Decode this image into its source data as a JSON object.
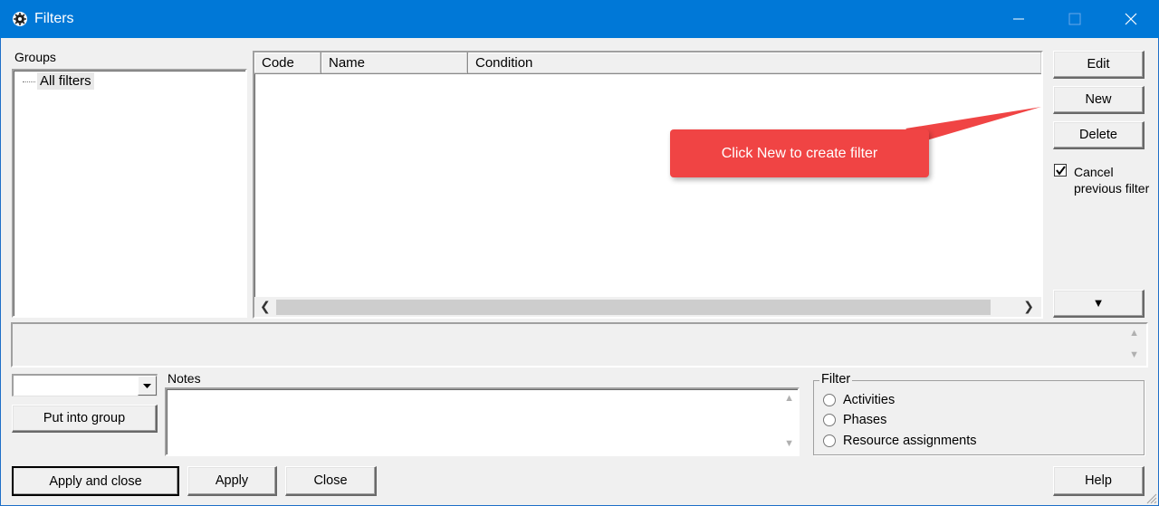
{
  "window": {
    "title": "Filters",
    "controls": {
      "minimize": "minimize",
      "maximize": "maximize",
      "close": "close"
    }
  },
  "groups": {
    "label": "Groups",
    "items": [
      {
        "label": "All filters"
      }
    ]
  },
  "filter_list": {
    "columns": [
      "Code",
      "Name",
      "Condition"
    ],
    "rows": []
  },
  "side_buttons": {
    "edit": "Edit",
    "new": "New",
    "delete": "Delete",
    "more": "▼"
  },
  "callout": {
    "text": "Click New to create filter"
  },
  "cancel_previous": {
    "label_line1": "Cancel",
    "label_line2": "previous filter",
    "checked": true
  },
  "group_select": {
    "value": ""
  },
  "put_into_group": "Put into group",
  "notes": {
    "label": "Notes",
    "value": ""
  },
  "filter_target": {
    "title": "Filter",
    "options": [
      "Activities",
      "Phases",
      "Resource assignments"
    ]
  },
  "bottom_buttons": {
    "apply_and_close": "Apply and close",
    "apply": "Apply",
    "close": "Close",
    "help": "Help"
  },
  "colors": {
    "titlebar": "#0078d7",
    "callout": "#f04444"
  }
}
